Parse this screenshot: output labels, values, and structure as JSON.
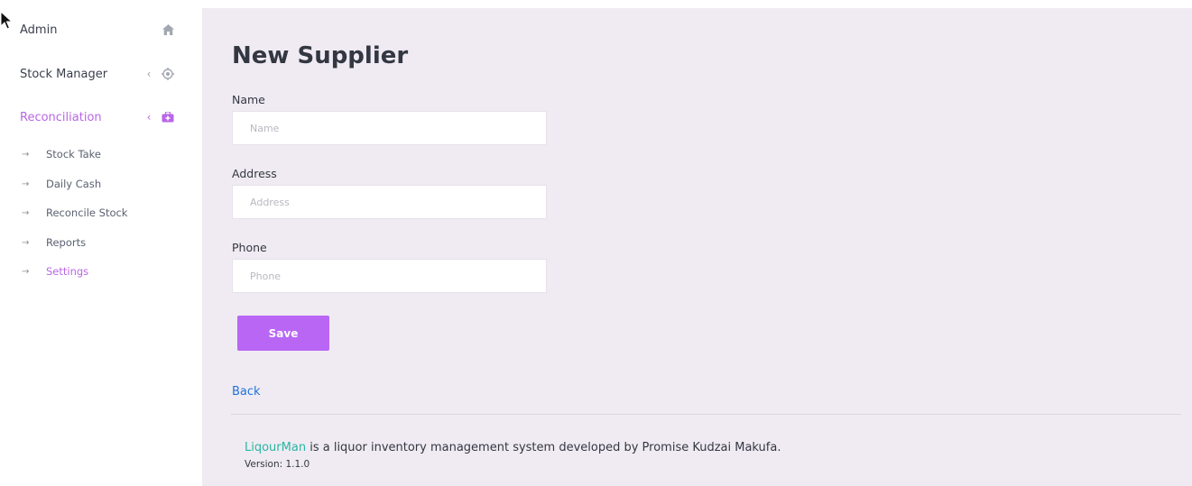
{
  "sidebar": {
    "items": [
      {
        "label": "Admin",
        "icon": "home-icon"
      },
      {
        "label": "Stock Manager",
        "icon": "target-icon"
      },
      {
        "label": "Reconciliation",
        "icon": "medkit-icon"
      }
    ],
    "subitems": [
      {
        "label": "Stock Take"
      },
      {
        "label": "Daily Cash"
      },
      {
        "label": "Reconcile Stock"
      },
      {
        "label": "Reports"
      },
      {
        "label": "Settings"
      }
    ]
  },
  "main": {
    "title": "New Supplier",
    "fields": {
      "name": {
        "label": "Name",
        "placeholder": "Name",
        "value": ""
      },
      "address": {
        "label": "Address",
        "placeholder": "Address",
        "value": ""
      },
      "phone": {
        "label": "Phone",
        "placeholder": "Phone",
        "value": ""
      }
    },
    "save_label": "Save",
    "back_label": "Back"
  },
  "footer": {
    "brand": "LiqourMan",
    "description": " is a liquor inventory management system developed by Promise Kudzai Makufa.",
    "version": "Version: 1.1.0"
  },
  "colors": {
    "accent": "#b966f5",
    "link": "#1f74d9",
    "brand": "#2ab5a4",
    "main_bg": "#f0ebf2"
  }
}
